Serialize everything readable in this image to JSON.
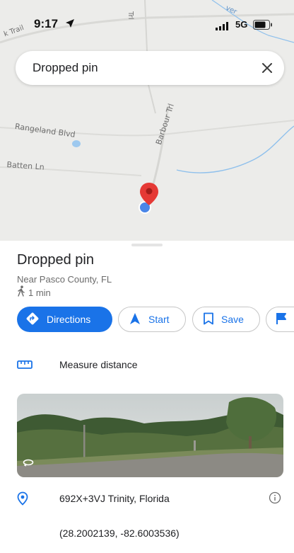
{
  "status_bar": {
    "time": "9:17",
    "network": "5G",
    "icons": [
      "location-arrow-icon",
      "signal-icon",
      "battery-icon"
    ]
  },
  "search": {
    "title": "Dropped pin",
    "close_icon": "close-icon"
  },
  "map": {
    "labels": {
      "rangeland": "Rangeland Blvd",
      "batten": "Batten Ln",
      "barbour": "Barbour Trl",
      "trail": "k Trail",
      "trl": "Trl",
      "river": "ver"
    }
  },
  "place": {
    "title": "Dropped pin",
    "subtitle": "Near Pasco County, FL",
    "walk_time": "1 min"
  },
  "actions": {
    "directions": "Directions",
    "start": "Start",
    "save": "Save"
  },
  "measure": {
    "label": "Measure distance"
  },
  "address": {
    "plus_code": "692X+3VJ Trinity, Florida"
  },
  "coordinates": "(28.2002139, -82.6003536)",
  "colors": {
    "accent": "#1a73e8",
    "pin_red": "#e53935",
    "location_blue": "#4285f4",
    "water": "#7db6e8"
  }
}
